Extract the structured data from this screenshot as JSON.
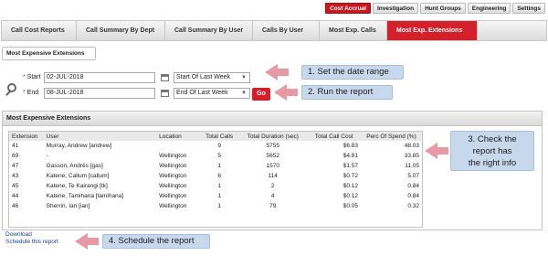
{
  "top_nav": [
    "Cost Accrual",
    "Investigation",
    "Hunt Groups",
    "Engineering",
    "Settings"
  ],
  "tabs": [
    "Call Cost Reports",
    "Call Summary By Dept",
    "Call Summary By User",
    "Calls By User",
    "Most Exp. Calls",
    "Most Exp. Extensions"
  ],
  "active_tab": "Most Exp. Extensions",
  "subtab": "Most Expensive Extensions",
  "form": {
    "start_label": "Start",
    "end_label": "End",
    "start_value": "02-JUL-2018",
    "end_value": "08-JUL-2018",
    "start_preset": "Start Of Last Week",
    "end_preset": "End Of Last Week",
    "go_label": "Go"
  },
  "annotations": {
    "a1": "1. Set the date range",
    "a2": "2. Run the report",
    "a3_line1": "3. Check the",
    "a3_line2": "report has",
    "a3_line3": "the right info",
    "a4": "4. Schedule the report"
  },
  "panel_title": "Most Expensive Extensions",
  "table": {
    "headers": [
      "Extension",
      "User",
      "Location",
      "Total Calls",
      "Total Duration (sec)",
      "Total Call Cost",
      "Perc Of Spend (%)"
    ],
    "rows": [
      [
        "41",
        "Murray, Andrew [andrew]",
        "",
        "9",
        "5755",
        "$6.83",
        "48.03"
      ],
      [
        "69",
        "-",
        "Wellington",
        "5",
        "5652",
        "$4.81",
        "33.85"
      ],
      [
        "47",
        "Gasson, Andrés [gas]",
        "Wellington",
        "1",
        "1570",
        "$1.57",
        "11.05"
      ],
      [
        "43",
        "Katene, Callum [callum]",
        "Wellington",
        "6",
        "114",
        "$0.72",
        "5.07"
      ],
      [
        "45",
        "Katene, Te Kairangi [tk]",
        "Wellington",
        "1",
        "2",
        "$0.12",
        "0.84"
      ],
      [
        "44",
        "Katene, Tamihana [tamihana]",
        "Wellington",
        "1",
        "4",
        "$0.12",
        "0.84"
      ],
      [
        "46",
        "Sherrin, Ian [ian]",
        "Wellington",
        "1",
        "79",
        "$0.05",
        "0.32"
      ]
    ]
  },
  "links": {
    "download": "Download",
    "schedule": "Schedule this report"
  },
  "colors": {
    "accent": "#d3202a",
    "callout": "#c7d8ec",
    "arrow": "#e89aa4"
  }
}
